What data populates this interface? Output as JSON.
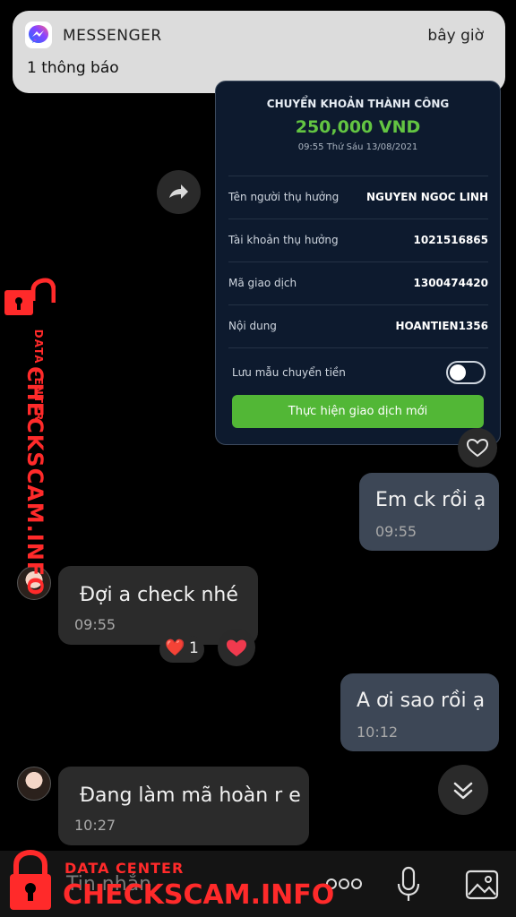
{
  "notification": {
    "app_name": "MESSENGER",
    "time": "bây giờ",
    "body": "1 thông báo",
    "icon": "messenger-icon"
  },
  "receipt": {
    "title": "CHUYỂN KHOẢN THÀNH CÔNG",
    "amount": "250,000 VND",
    "datetime": "09:55 Thứ Sáu 13/08/2021",
    "rows": [
      {
        "label": "Tên người thụ hưởng",
        "value": "NGUYEN NGOC LINH"
      },
      {
        "label": "Tài khoản thụ hưởng",
        "value": "1021516865"
      },
      {
        "label": "Mã giao dịch",
        "value": "1300474420"
      },
      {
        "label": "Nội dung",
        "value": "HOANTIEN1356"
      }
    ],
    "save_template_label": "Lưu mẫu chuyển tiền",
    "save_template_on": false,
    "new_transaction_button": "Thực hiện giao dịch mới",
    "accent_color": "#52b736"
  },
  "messages": [
    {
      "direction": "sent",
      "text": "Em ck rồi ạ",
      "time": "09:55"
    },
    {
      "direction": "received",
      "text": "Đợi a check nhé",
      "time": "09:55",
      "reaction": "❤️",
      "reaction_count": "1"
    },
    {
      "direction": "sent",
      "text": "A ơi sao rồi ạ",
      "time": "10:12"
    },
    {
      "direction": "received",
      "text": "Đang làm mã hoàn r e",
      "time": "10:27"
    }
  ],
  "composer": {
    "placeholder": "Tin nhắn",
    "icons": [
      "more-icon",
      "microphone-icon",
      "gallery-icon"
    ]
  },
  "watermark": {
    "label": "DATA CENTER",
    "brand": "CHECKSCAM.INFO",
    "color": "#ff2a2a"
  }
}
